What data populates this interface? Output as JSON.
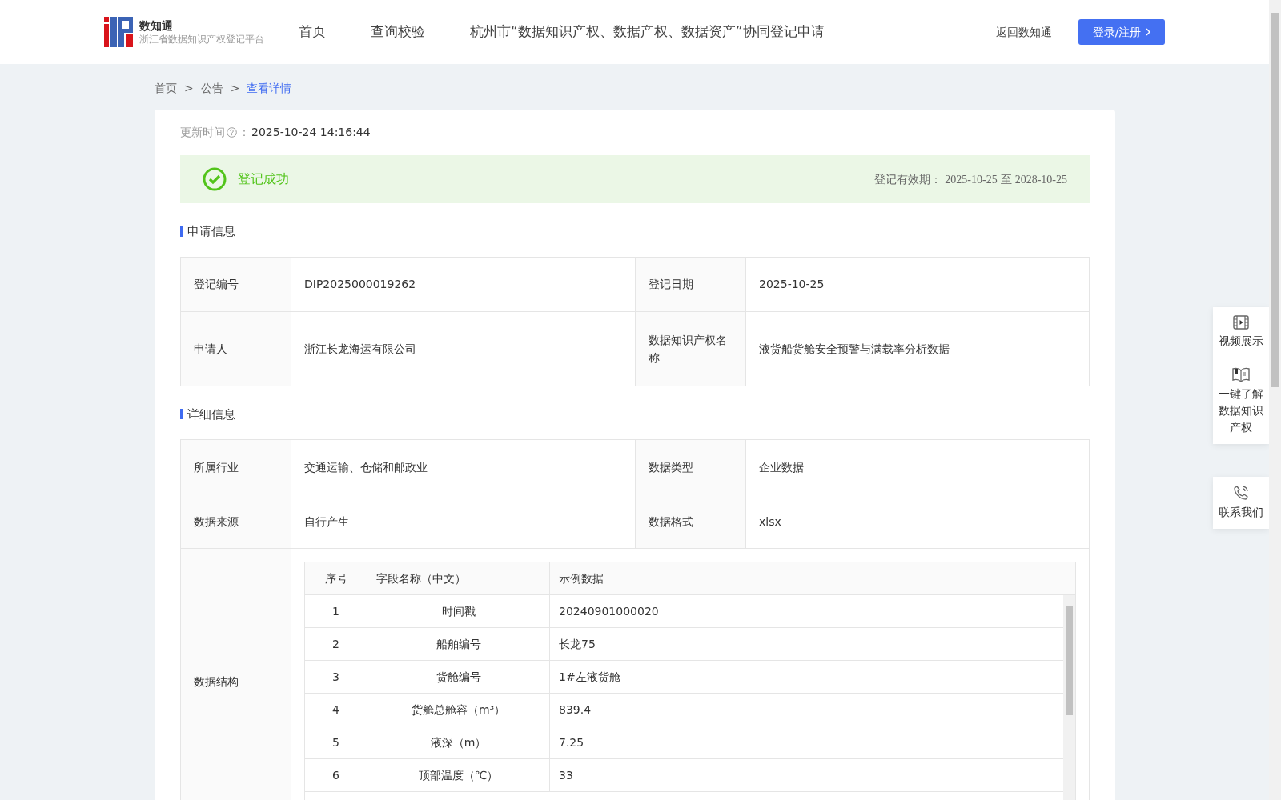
{
  "header": {
    "logo_title": "数知通",
    "logo_subtitle": "浙江省数据知识产权登记平台",
    "nav": [
      {
        "label": "首页",
        "selected": false
      },
      {
        "label": "查询校验",
        "selected": false
      },
      {
        "label": "杭州市“数据知识产权、数据产权、数据资产”协同登记申请",
        "selected": false
      }
    ],
    "back_link": "返回数知通",
    "login_button": "登录/注册"
  },
  "breadcrumb": [
    {
      "label": "首页",
      "selected": false
    },
    {
      "label": "公告",
      "selected": false
    },
    {
      "label": "查看详情",
      "selected": true
    }
  ],
  "breadcrumb_separator": ">",
  "update": {
    "label": "更新时间",
    "colon": "：",
    "value": "2025-10-24 14:16:44"
  },
  "status": {
    "text": "登记成功",
    "validity_label": "登记有效期：",
    "validity_from": "2025-10-25",
    "validity_to_word": "至",
    "validity_to": "2028-10-25"
  },
  "sections": [
    {
      "title": "申请信息",
      "rows": [
        [
          "登记编号",
          "DIP2025000019262",
          "登记日期",
          "2025-10-25"
        ],
        [
          "申请人",
          "浙江长龙海运有限公司",
          "数据知识产权名称",
          "液货船货舱安全预警与满载率分析数据"
        ]
      ]
    },
    {
      "title": "详细信息",
      "rows": [
        [
          "所属行业",
          "交通运输、仓储和邮政业",
          "数据类型",
          "企业数据"
        ],
        [
          "数据来源",
          "自行产生",
          "数据格式",
          "xlsx"
        ]
      ],
      "structure": {
        "label": "数据结构",
        "columns": [
          "序号",
          "字段名称（中文）",
          "示例数据"
        ],
        "rows": [
          [
            "1",
            "时间戳",
            "20240901000020"
          ],
          [
            "2",
            "船舶编号",
            "长龙75"
          ],
          [
            "3",
            "货舱编号",
            "1#左液货舱"
          ],
          [
            "4",
            "货舱总舱容（m³）",
            "839.4"
          ],
          [
            "5",
            "液深（m）",
            "7.25"
          ],
          [
            "6",
            "顶部温度（℃）",
            "33"
          ]
        ]
      }
    }
  ],
  "float_panel": [
    {
      "kind": "video",
      "label": "视频展示"
    },
    {
      "kind": "book",
      "label": "一键了解数据知识产权"
    },
    {
      "kind": "phone",
      "label": "联系我们"
    }
  ]
}
